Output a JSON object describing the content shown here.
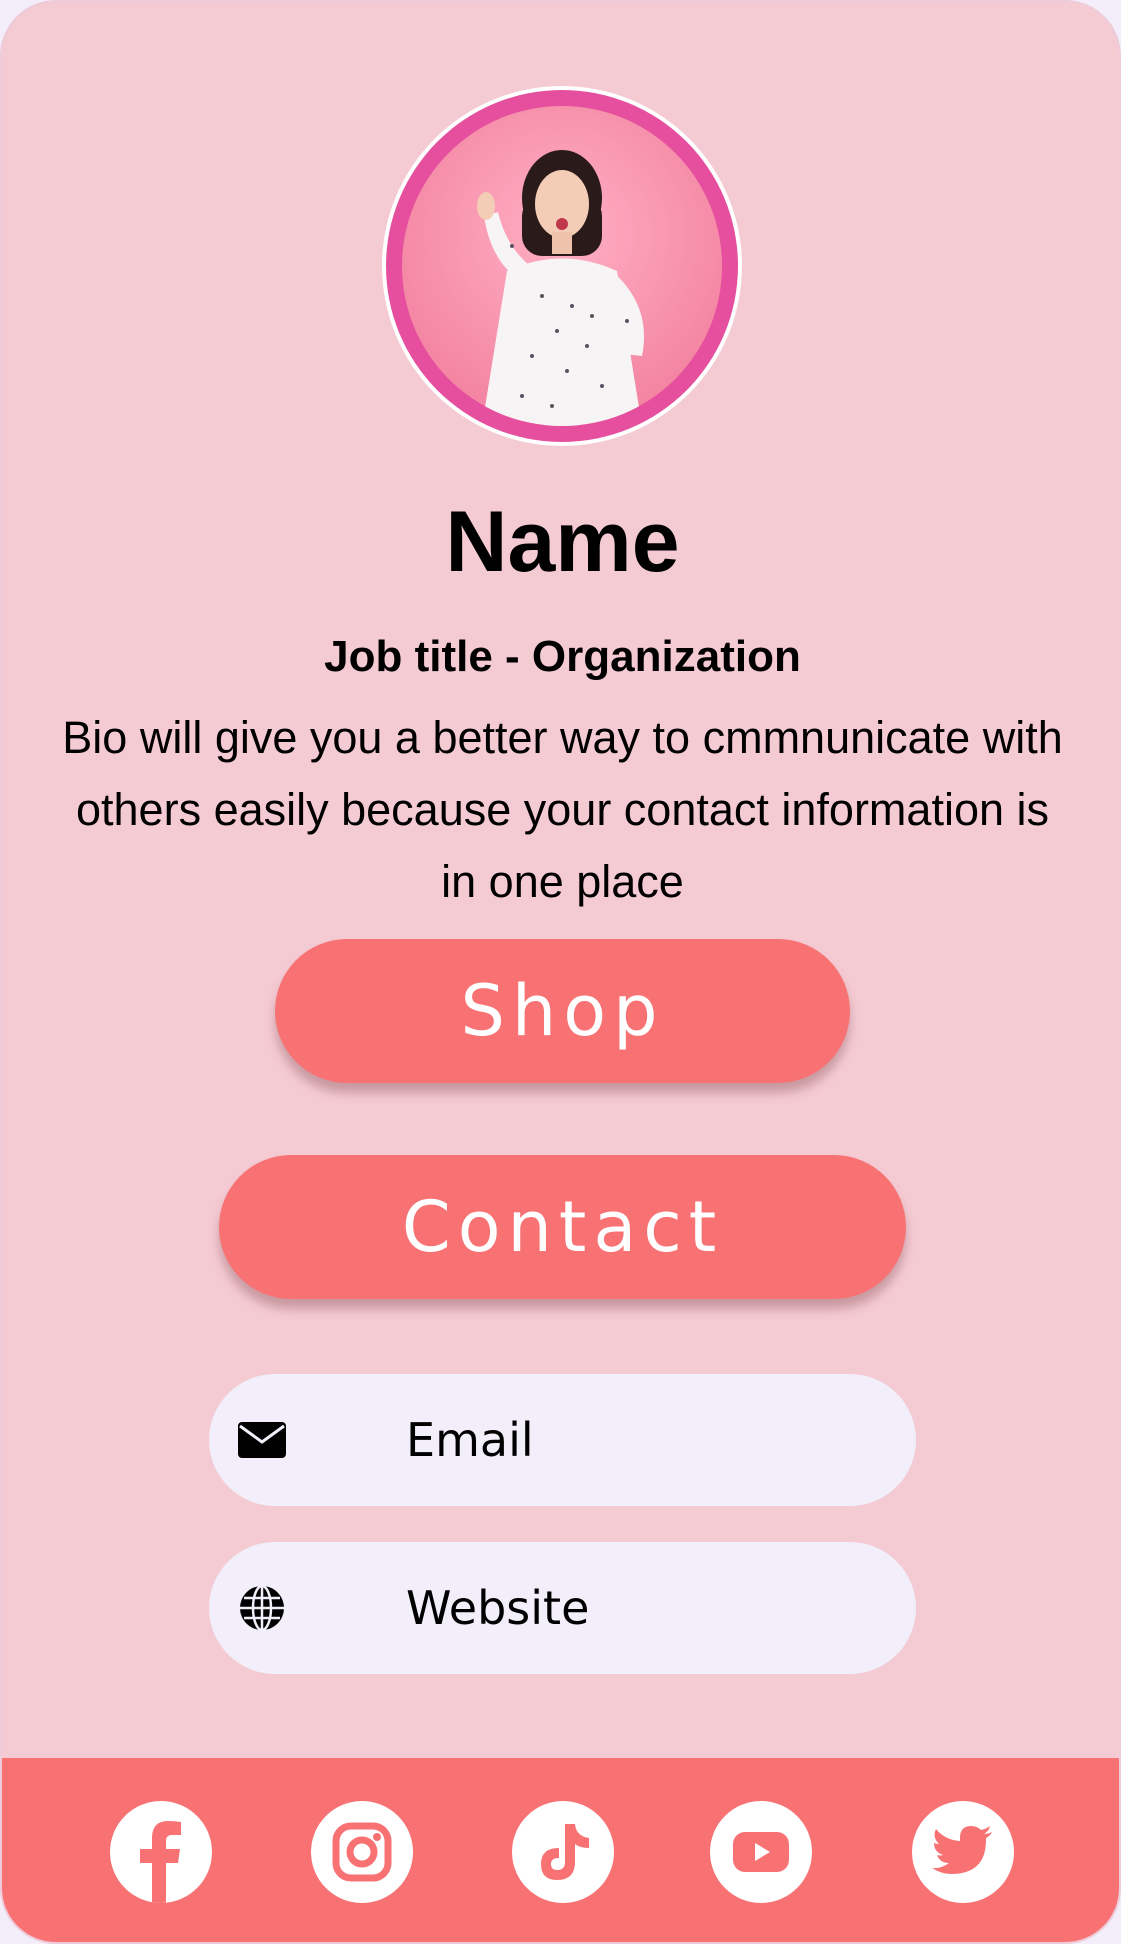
{
  "profile": {
    "name": "Name",
    "job_title": "Job title - Organization",
    "bio": "Bio will give you a better way to cmmnunicate with others easily because your contact information is in one place"
  },
  "buttons": {
    "shop_label": "Shop",
    "contact_label": "Contact"
  },
  "links": {
    "email_label": "Email",
    "email_icon": "envelope-icon",
    "website_label": "Website",
    "website_icon": "globe-icon"
  },
  "social": [
    {
      "name": "facebook",
      "icon": "facebook-icon"
    },
    {
      "name": "instagram",
      "icon": "instagram-icon"
    },
    {
      "name": "tiktok",
      "icon": "tiktok-icon"
    },
    {
      "name": "youtube",
      "icon": "youtube-icon"
    },
    {
      "name": "twitter",
      "icon": "twitter-icon"
    }
  ],
  "colors": {
    "page_background": "#f3eefa",
    "card_background": "#f5cbd3",
    "accent": "#f87274",
    "avatar_ring": "#e54f9e",
    "pill_background": "#f2eefa",
    "text": "#000000",
    "button_text": "#ffffff"
  }
}
